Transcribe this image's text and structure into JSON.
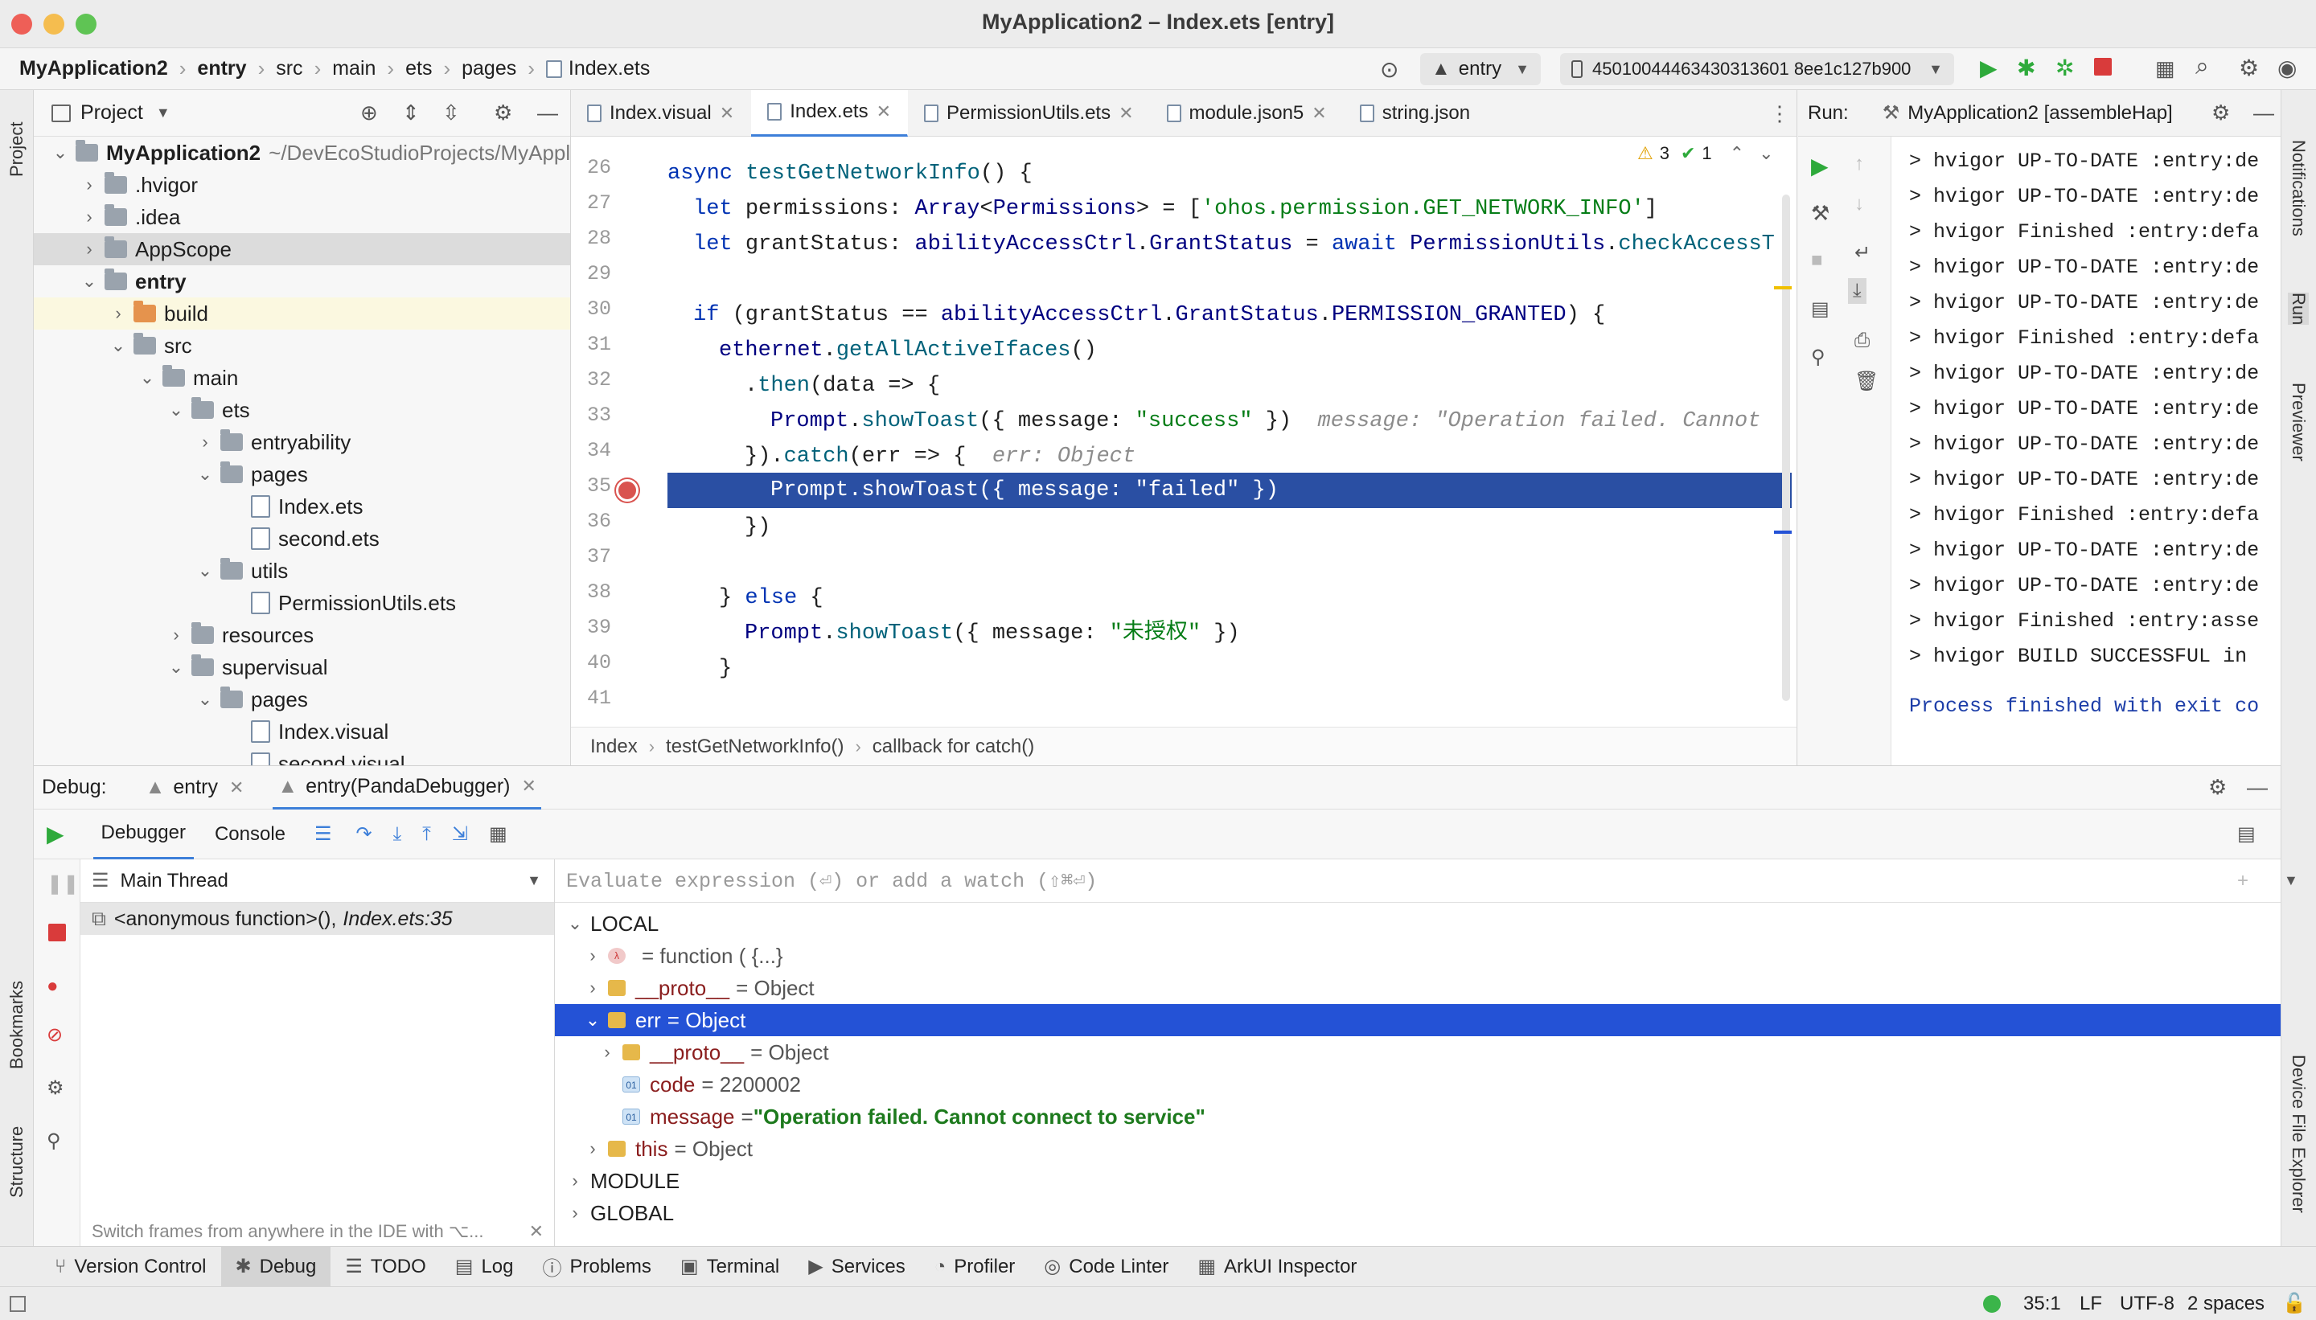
{
  "window": {
    "title": "MyApplication2 – Index.ets [entry]"
  },
  "navbar": {
    "crumbs": [
      "MyApplication2",
      "entry",
      "src",
      "main",
      "ets",
      "pages",
      "Index.ets"
    ],
    "module_select": "entry",
    "device_select": "45010044463430313601 8ee1c127b900"
  },
  "project": {
    "title": "Project",
    "tree": [
      {
        "label": "MyApplication2",
        "suffix": "~/DevEcoStudioProjects/MyAppl",
        "kind": "folder",
        "open": true,
        "level": 0
      },
      {
        "label": ".hvigor",
        "kind": "folder",
        "open": false,
        "level": 1
      },
      {
        "label": ".idea",
        "kind": "folder",
        "open": false,
        "level": 1
      },
      {
        "label": "AppScope",
        "kind": "folder",
        "open": false,
        "level": 1
      },
      {
        "label": "entry",
        "kind": "folder",
        "open": true,
        "level": 1
      },
      {
        "label": "build",
        "kind": "folder-orange",
        "open": false,
        "level": 2
      },
      {
        "label": "src",
        "kind": "folder",
        "open": true,
        "level": 2
      },
      {
        "label": "main",
        "kind": "folder",
        "open": true,
        "level": 3
      },
      {
        "label": "ets",
        "kind": "folder",
        "open": true,
        "level": 4
      },
      {
        "label": "entryability",
        "kind": "folder",
        "open": false,
        "level": 5
      },
      {
        "label": "pages",
        "kind": "folder",
        "open": true,
        "level": 5
      },
      {
        "label": "Index.ets",
        "kind": "file",
        "level": 6
      },
      {
        "label": "second.ets",
        "kind": "file",
        "level": 6
      },
      {
        "label": "utils",
        "kind": "folder",
        "open": true,
        "level": 5
      },
      {
        "label": "PermissionUtils.ets",
        "kind": "file",
        "level": 6
      },
      {
        "label": "resources",
        "kind": "folder",
        "open": false,
        "level": 4
      },
      {
        "label": "supervisual",
        "kind": "folder",
        "open": true,
        "level": 4
      },
      {
        "label": "pages",
        "kind": "folder",
        "open": true,
        "level": 5
      },
      {
        "label": "Index.visual",
        "kind": "file",
        "level": 6
      },
      {
        "label": "second.visual",
        "kind": "file",
        "level": 6
      }
    ]
  },
  "editor": {
    "tabs": [
      "Index.visual",
      "Index.ets",
      "PermissionUtils.ets",
      "module.json5",
      "string.json"
    ],
    "active_tab": "Index.ets",
    "warnings": "3",
    "checks": "1",
    "line_numbers": [
      "26",
      "27",
      "28",
      "29",
      "30",
      "31",
      "32",
      "33",
      "34",
      "35",
      "36",
      "37",
      "38",
      "39",
      "40",
      "41"
    ],
    "breadcrumbs": [
      "Index",
      "testGetNetworkInfo()",
      "callback for catch()"
    ]
  },
  "run": {
    "label": "Run:",
    "config": "MyApplication2 [assembleHap]",
    "lines": [
      "> hvigor UP-TO-DATE :entry:de",
      "> hvigor UP-TO-DATE :entry:de",
      "> hvigor Finished :entry:defa",
      "> hvigor UP-TO-DATE :entry:de",
      "> hvigor UP-TO-DATE :entry:de",
      "> hvigor Finished :entry:defa",
      "> hvigor UP-TO-DATE :entry:de",
      "> hvigor UP-TO-DATE :entry:de",
      "> hvigor UP-TO-DATE :entry:de",
      "> hvigor UP-TO-DATE :entry:de",
      "> hvigor Finished :entry:defa",
      "> hvigor UP-TO-DATE :entry:de",
      "> hvigor UP-TO-DATE :entry:de",
      "> hvigor Finished :entry:asse",
      "> hvigor BUILD SUCCESSFUL in"
    ],
    "exit_line": "Process finished with exit co"
  },
  "debug": {
    "label": "Debug:",
    "sessions": [
      "entry",
      "entry(PandaDebugger)"
    ],
    "tabs": [
      "Debugger",
      "Console"
    ],
    "thread": "Main Thread",
    "frame_name": "<anonymous function>(),",
    "frame_loc": "Index.ets:35",
    "hint": "Switch frames from anywhere in the IDE with ⌥...",
    "eval_placeholder": "Evaluate expression (⏎) or add a watch (⇧⌘⏎)",
    "vars": [
      {
        "text": "LOCAL",
        "kind": "section",
        "open": true,
        "level": 0
      },
      {
        "name": "",
        "eq": "= function ( {...}",
        "kind": "fn",
        "open": false,
        "level": 1
      },
      {
        "name": "__proto__",
        "eq": "= Object",
        "kind": "obj",
        "open": false,
        "level": 1
      },
      {
        "name": "err",
        "eq": "= Object",
        "kind": "obj",
        "open": true,
        "level": 1,
        "selected": true
      },
      {
        "name": "__proto__",
        "eq": "= Object",
        "kind": "obj",
        "open": false,
        "level": 2
      },
      {
        "name": "code",
        "eq": "= 2200002",
        "kind": "num",
        "level": 2
      },
      {
        "name": "message",
        "eq": "= ",
        "str": "\"Operation failed. Cannot connect to service\"",
        "kind": "num",
        "level": 2
      },
      {
        "name": "this",
        "eq": "= Object",
        "kind": "obj",
        "open": false,
        "level": 1
      },
      {
        "text": "MODULE",
        "kind": "section",
        "open": false,
        "level": 0
      },
      {
        "text": "GLOBAL",
        "kind": "section",
        "open": false,
        "level": 0
      }
    ]
  },
  "sidebars": {
    "left": [
      "Project",
      "Bookmarks",
      "Structure"
    ],
    "right": [
      "Notifications",
      "Run",
      "Previewer",
      "Device File Explorer"
    ]
  },
  "toolwindows": [
    "Version Control",
    "Debug",
    "TODO",
    "Log",
    "Problems",
    "Terminal",
    "Services",
    "Profiler",
    "Code Linter",
    "ArkUI Inspector"
  ],
  "status": {
    "position": "35:1",
    "line_sep": "LF",
    "encoding": "UTF-8",
    "indent": "2 spaces"
  },
  "colors": {
    "accent": "#2452d6",
    "code_highlight": "#2a4fa3",
    "run_green": "#2eaa3b",
    "stop_red": "#d93b3b"
  }
}
